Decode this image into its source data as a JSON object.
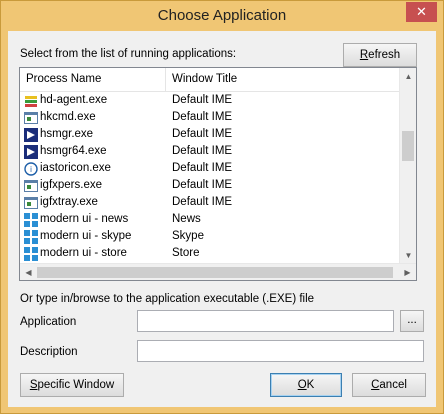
{
  "window": {
    "title": "Choose Application",
    "close_glyph": "✕"
  },
  "list": {
    "prompt": "Select from the list of running applications:",
    "refresh_label": "Refresh",
    "columns": [
      "Process Name",
      "Window Title"
    ],
    "rows": [
      {
        "process": "hd-agent.exe",
        "title": "Default IME",
        "icon": "bluestacks-icon"
      },
      {
        "process": "hkcmd.exe",
        "title": "Default IME",
        "icon": "window-icon"
      },
      {
        "process": "hsmgr.exe",
        "title": "Default IME",
        "icon": "hotkey-icon"
      },
      {
        "process": "hsmgr64.exe",
        "title": "Default IME",
        "icon": "hotkey-icon"
      },
      {
        "process": "iastoricon.exe",
        "title": "Default IME",
        "icon": "intel-icon"
      },
      {
        "process": "igfxpers.exe",
        "title": "Default IME",
        "icon": "window-icon"
      },
      {
        "process": "igfxtray.exe",
        "title": "Default IME",
        "icon": "window-icon"
      },
      {
        "process": "modern ui - news",
        "title": "News",
        "icon": "modern-ui-icon"
      },
      {
        "process": "modern ui - skype",
        "title": "Skype",
        "icon": "modern-ui-icon"
      },
      {
        "process": "modern ui - store",
        "title": "Store",
        "icon": "modern-ui-icon"
      }
    ]
  },
  "form": {
    "browse_prompt": "Or type in/browse to the application executable (.EXE) file",
    "application_label": "Application",
    "application_value": "",
    "browse_label": "...",
    "description_label": "Description",
    "description_value": ""
  },
  "buttons": {
    "specific_window": "Specific Window",
    "ok": "OK",
    "cancel": "Cancel"
  },
  "colors": {
    "frame": "#f0c674",
    "close": "#c75050",
    "accent": "#3c7fb1"
  }
}
